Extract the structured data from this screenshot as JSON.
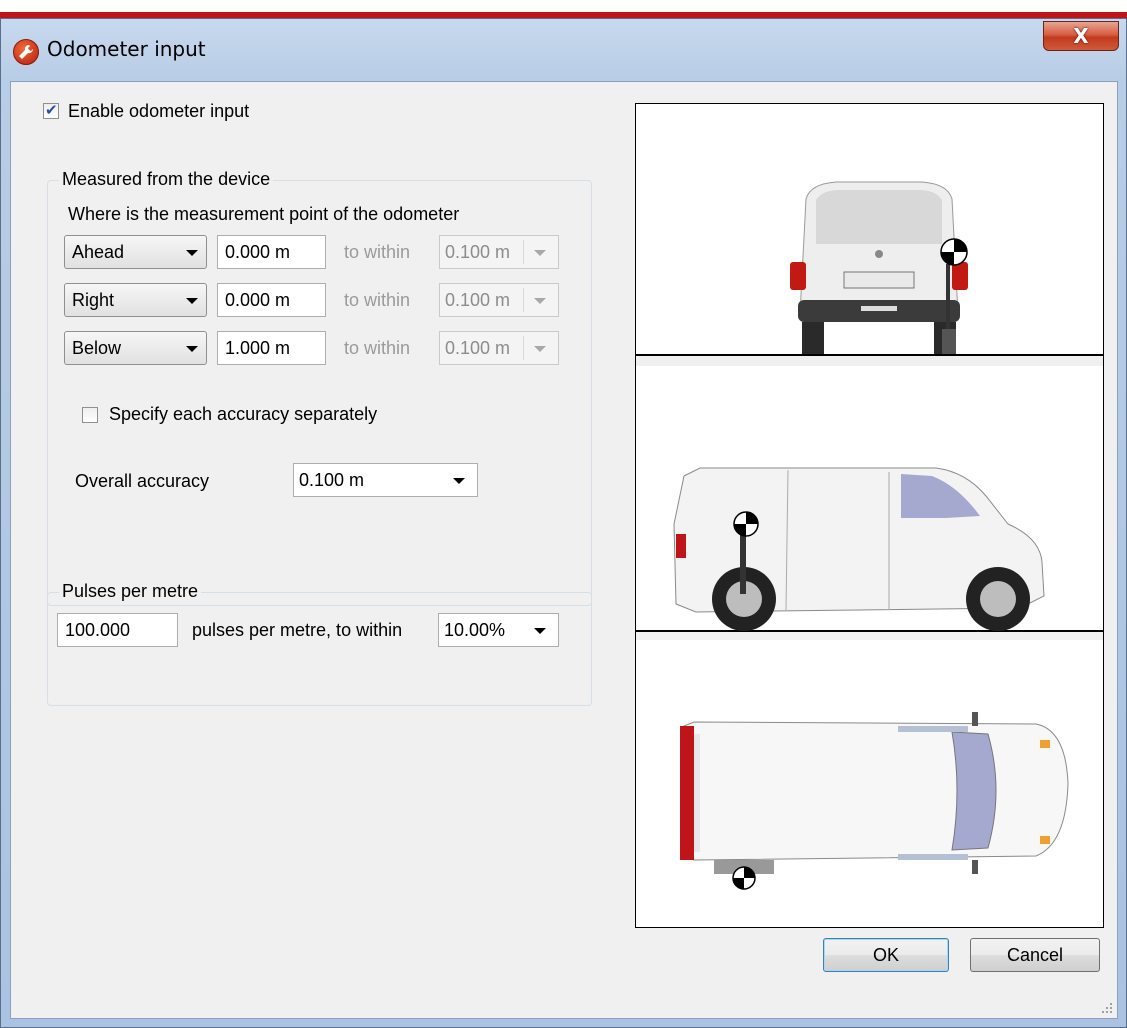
{
  "window": {
    "title": "Odometer input",
    "close_label": "X"
  },
  "enable": {
    "label": "Enable odometer input",
    "checked": true
  },
  "measured_group": {
    "title": "Measured from the device",
    "heading": "Where is the measurement point of the odometer",
    "rows": [
      {
        "direction": "Ahead",
        "value": "0.000 m",
        "within_label": "to within",
        "accuracy": "0.100 m"
      },
      {
        "direction": "Right",
        "value": "0.000 m",
        "within_label": "to within",
        "accuracy": "0.100 m"
      },
      {
        "direction": "Below",
        "value": "1.000 m",
        "within_label": "to within",
        "accuracy": "0.100 m"
      }
    ],
    "specify_separately": {
      "label": "Specify each accuracy separately",
      "checked": false
    },
    "overall_label": "Overall accuracy",
    "overall_value": "0.100 m"
  },
  "pulses_group": {
    "title": "Pulses per metre",
    "value": "100.000",
    "label": "pulses per metre, to within",
    "accuracy": "10.00%"
  },
  "buttons": {
    "ok": "OK",
    "cancel": "Cancel"
  },
  "icons": [
    "wrench-icon",
    "close-icon",
    "checkbox-checked-icon",
    "dropdown-arrow-icon",
    "resize-grip-icon"
  ],
  "colors": {
    "accent_red": "#c0141b",
    "target_black": "#000000",
    "window_blue": "#b8cde6"
  }
}
